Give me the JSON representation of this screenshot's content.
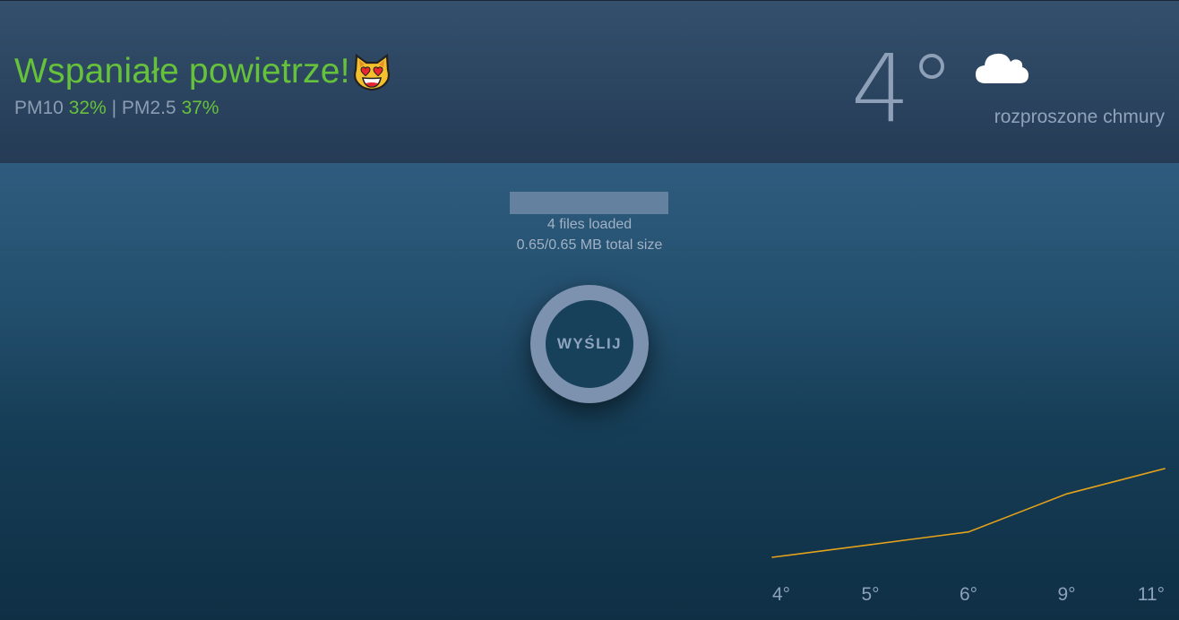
{
  "air_quality": {
    "title": "Wspaniałe powietrze!",
    "emoji": "heart-eyes-cat-icon",
    "pm10_label": "PM10",
    "pm10_value": "32%",
    "separator": "|",
    "pm25_label": "PM2.5",
    "pm25_value": "37%",
    "status_color": "#66c23a"
  },
  "weather": {
    "temperature": "4°",
    "icon": "cloud-icon",
    "description": "rozproszone chmury"
  },
  "upload": {
    "progress": 1.0,
    "files_loaded": "4 files loaded",
    "total_size": "0.65/0.65 MB total size",
    "send_label": "WYŚLIJ"
  },
  "chart_data": {
    "type": "line",
    "color": "#e3a21a",
    "x": [
      0,
      1,
      2,
      3,
      4
    ],
    "values": [
      4,
      5,
      6,
      9,
      11
    ],
    "tick_labels": [
      "4°",
      "5°",
      "6°",
      "9°",
      "11°"
    ],
    "ylim": [
      4,
      11
    ]
  }
}
